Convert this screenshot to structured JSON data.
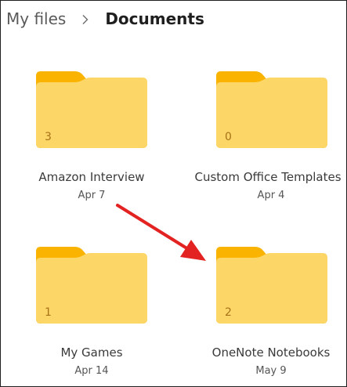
{
  "breadcrumb": {
    "root": "My files",
    "current": "Documents",
    "separator_icon": "chevron-right-icon"
  },
  "folders": [
    {
      "name": "Amazon Interview",
      "date": "Apr 7",
      "count": "3"
    },
    {
      "name": "Custom Office Templates",
      "date": "Apr 4",
      "count": "0"
    },
    {
      "name": "My Games",
      "date": "Apr 14",
      "count": "1"
    },
    {
      "name": "OneNote Notebooks",
      "date": "May 9",
      "count": "2"
    }
  ],
  "colors": {
    "folder_front": "#fcd666",
    "folder_back": "#f9b300",
    "folder_paper": "#ffffff",
    "annotation_arrow": "#e32222"
  },
  "annotation": {
    "icon": "red-arrow-icon",
    "points_to": "OneNote Notebooks"
  }
}
